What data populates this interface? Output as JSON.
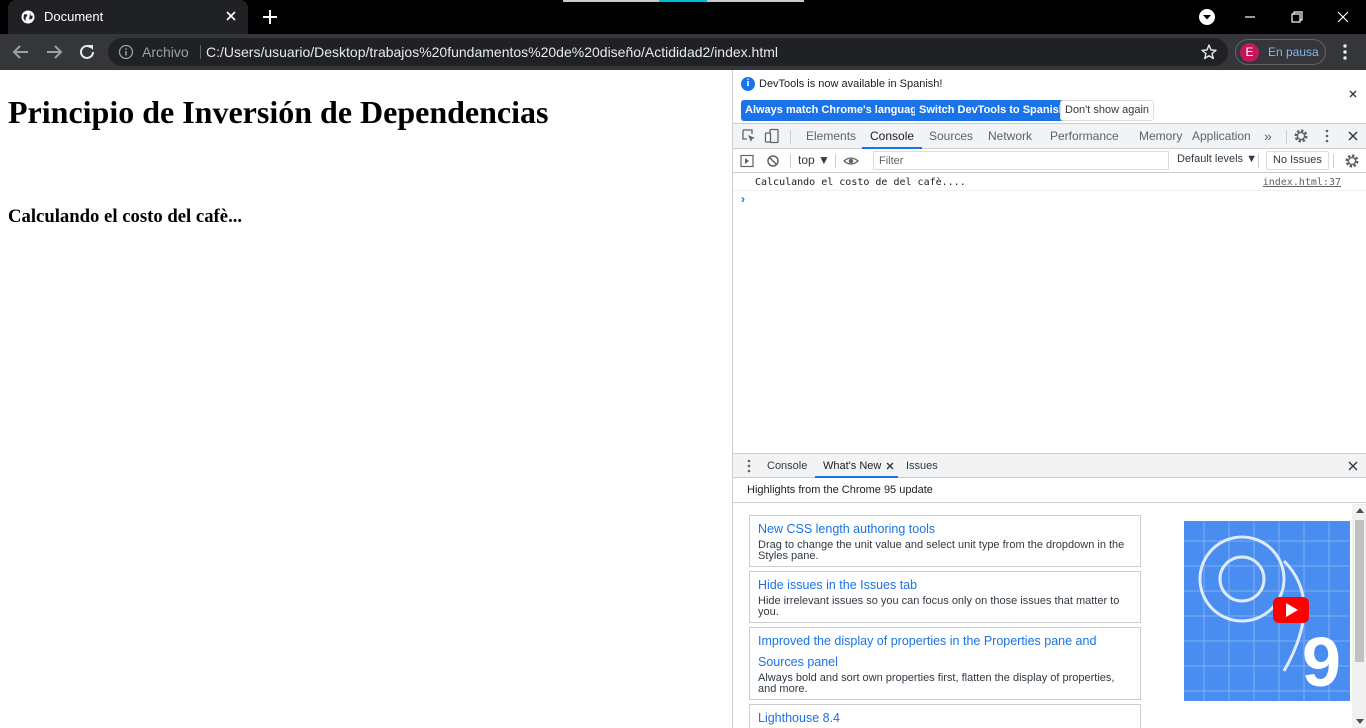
{
  "browser": {
    "tab_title": "Document",
    "url_scheme": "Archivo",
    "url": "C:/Users/usuario/Desktop/trabajos%20fundamentos%20de%20diseño/Actididad2/index.html",
    "profile_initial": "E",
    "profile_label": "En pausa"
  },
  "page": {
    "heading": "Principio de Inversión de Dependencias",
    "subheading": "Calculando el costo del cafè..."
  },
  "devtools": {
    "infobar": {
      "message": "DevTools is now available in Spanish!",
      "btn_match": "Always match Chrome's language",
      "btn_switch": "Switch DevTools to Spanish",
      "btn_dismiss": "Don't show again"
    },
    "tabs": [
      "Elements",
      "Console",
      "Sources",
      "Network",
      "Performance",
      "Memory",
      "Application"
    ],
    "more_tabs": "»",
    "console_toolbar": {
      "context": "top ▼",
      "filter_placeholder": "Filter",
      "levels": "Default levels ▼",
      "issues": "No Issues"
    },
    "log": {
      "message": "Calculando el costo de del cafè....",
      "source": "index.html:37"
    },
    "prompt": "›",
    "drawer": {
      "tabs": [
        "Console",
        "What's New",
        "Issues"
      ],
      "heading": "Highlights from the Chrome 95 update",
      "cards": [
        {
          "title": "New CSS length authoring tools",
          "desc": "Drag to change the unit value and select unit type from the dropdown in the Styles pane."
        },
        {
          "title": "Hide issues in the Issues tab",
          "desc": "Hide irrelevant issues so you can focus only on those issues that matter to you."
        },
        {
          "title": "Improved the display of properties in the Properties pane and Sources panel",
          "desc": "Always bold and sort own properties first, flatten the display of properties, and more."
        },
        {
          "title": "Lighthouse 8.4",
          "desc": ""
        }
      ]
    }
  },
  "colors": {
    "accent": "#1a73e8",
    "tab_bg": "#202124",
    "toolbar_bg": "#35363a",
    "profile_avatar": "#c2185b"
  }
}
